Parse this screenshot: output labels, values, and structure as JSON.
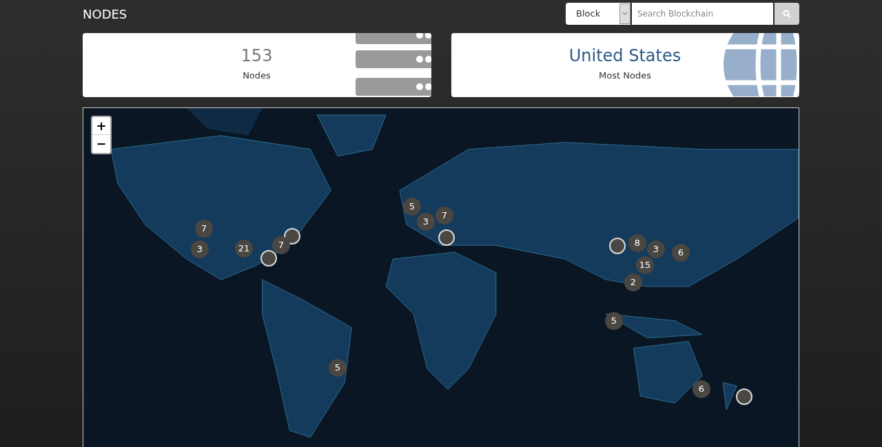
{
  "page_title": "NODES",
  "search": {
    "type_select": "Block",
    "placeholder": "Search Blockchain"
  },
  "stats": [
    {
      "kind": "servers",
      "value": "153",
      "label": "Nodes"
    },
    {
      "kind": "globe",
      "value": "United States",
      "label": "Most Nodes"
    }
  ],
  "map": {
    "kind": "picture",
    "zoom_in": "+",
    "zoom_out": "−",
    "markers": [
      {
        "kind": "point"
      },
      {
        "kind": "point"
      },
      {
        "kind": "point"
      },
      {
        "kind": "point"
      },
      {
        "kind": "point"
      },
      {
        "kind": "cluster",
        "count": "5"
      },
      {
        "kind": "cluster",
        "count": "3"
      },
      {
        "kind": "cluster",
        "count": "7"
      },
      {
        "kind": "cluster",
        "count": "7"
      },
      {
        "kind": "cluster",
        "count": "3"
      },
      {
        "kind": "cluster",
        "count": "21"
      },
      {
        "kind": "cluster",
        "count": "7"
      },
      {
        "kind": "cluster",
        "count": "8"
      },
      {
        "kind": "cluster",
        "count": "3"
      },
      {
        "kind": "cluster",
        "count": "6"
      },
      {
        "kind": "cluster",
        "count": "15"
      },
      {
        "kind": "cluster",
        "count": "2"
      },
      {
        "kind": "cluster",
        "count": "5"
      },
      {
        "kind": "cluster",
        "count": "5"
      },
      {
        "kind": "cluster",
        "count": "6"
      }
    ]
  }
}
